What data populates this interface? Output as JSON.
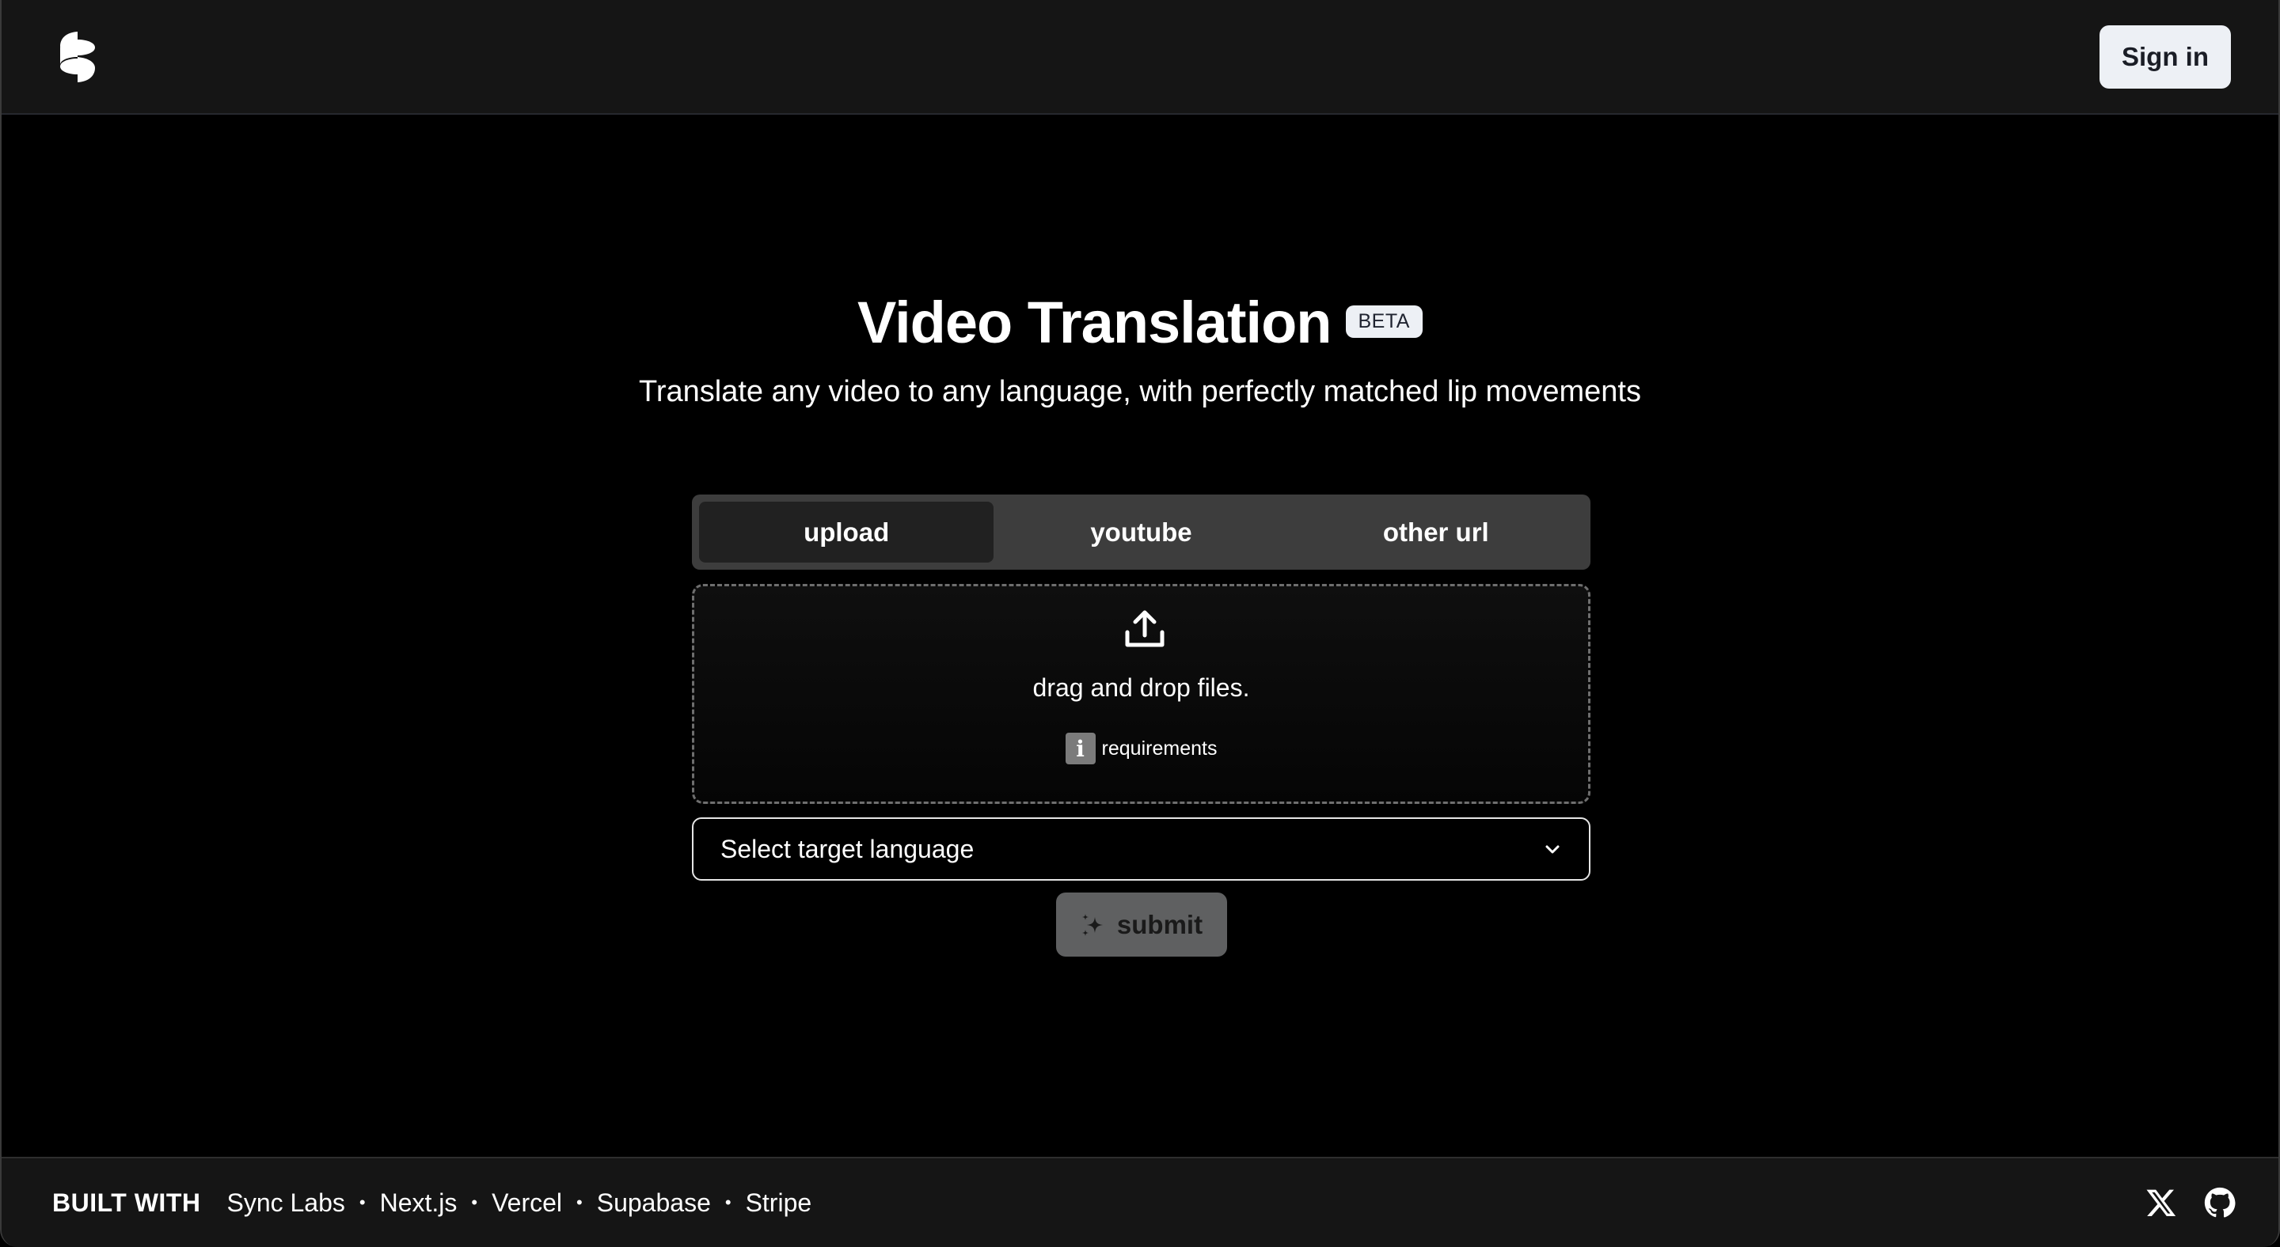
{
  "header": {
    "logo": "sync-labs-logo",
    "signin_label": "Sign in"
  },
  "hero": {
    "title": "Video Translation",
    "badge": "BETA",
    "subtitle": "Translate any video to any language, with perfectly matched lip movements"
  },
  "tabs": [
    {
      "label": "upload",
      "active": true
    },
    {
      "label": "youtube",
      "active": false
    },
    {
      "label": "other url",
      "active": false
    }
  ],
  "dropzone": {
    "icon": "upload-icon",
    "text": "drag and drop files.",
    "requirements_icon": "info-icon",
    "requirements_label": "requirements"
  },
  "language_select": {
    "placeholder": "Select target language"
  },
  "submit": {
    "icon": "sparkle-icon",
    "label": "submit"
  },
  "footer": {
    "built_with": "BUILT WITH",
    "links": [
      "Sync Labs",
      "Next.js",
      "Vercel",
      "Supabase",
      "Stripe"
    ],
    "separator": "•",
    "social": [
      "x-icon",
      "github-icon"
    ]
  },
  "colors": {
    "background": "#000000",
    "bar": "#151515",
    "tabs_bg": "#3d3d3d",
    "tab_active": "#212121",
    "button_light": "#edf0f5",
    "submit_disabled": "#5f6061"
  }
}
